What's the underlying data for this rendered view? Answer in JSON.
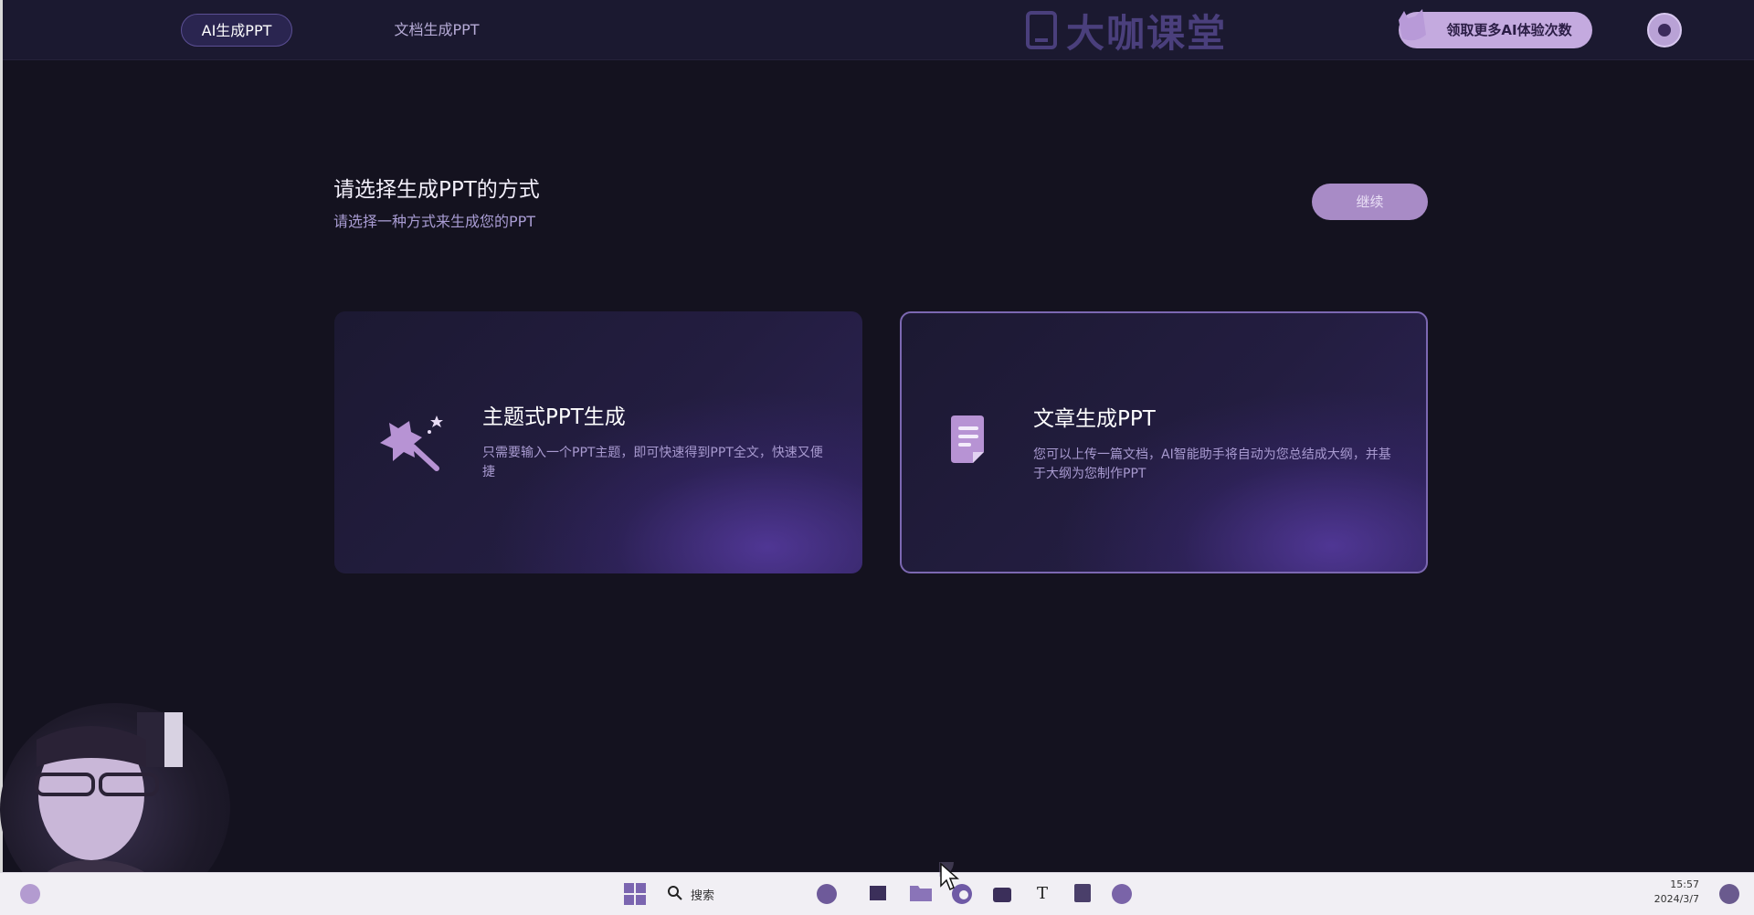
{
  "topbar": {
    "tabs": [
      {
        "label": "AI生成PPT",
        "active": true
      },
      {
        "label": "文档生成PPT",
        "active": false
      }
    ],
    "logo_text": "大咖课堂",
    "promo_label": "领取更多AI体验次数",
    "avatar": "avatar-icon"
  },
  "main": {
    "heading": "请选择生成PPT的方式",
    "subheading": "请选择一种方式来生成您的PPT",
    "continue_label": "继续",
    "cards": [
      {
        "title": "主题式PPT生成",
        "description": "只需要输入一个PPT主题，即可快速得到PPT全文，快速又便捷",
        "icon": "magic-wand-icon",
        "selected": false
      },
      {
        "title": "文章生成PPT",
        "description": "您可以上传一篇文档，AI智能助手将自动为您总结成大纲，并基于大纲为您制作PPT",
        "icon": "document-icon",
        "selected": true
      }
    ]
  },
  "taskbar": {
    "search_label": "搜索",
    "time": "15:57",
    "date": "2024/3/7"
  },
  "colors": {
    "background": "#14121f",
    "accent": "#a88bc6",
    "promo": "#c4aadf",
    "card_border_selected": "#7c68b2"
  }
}
